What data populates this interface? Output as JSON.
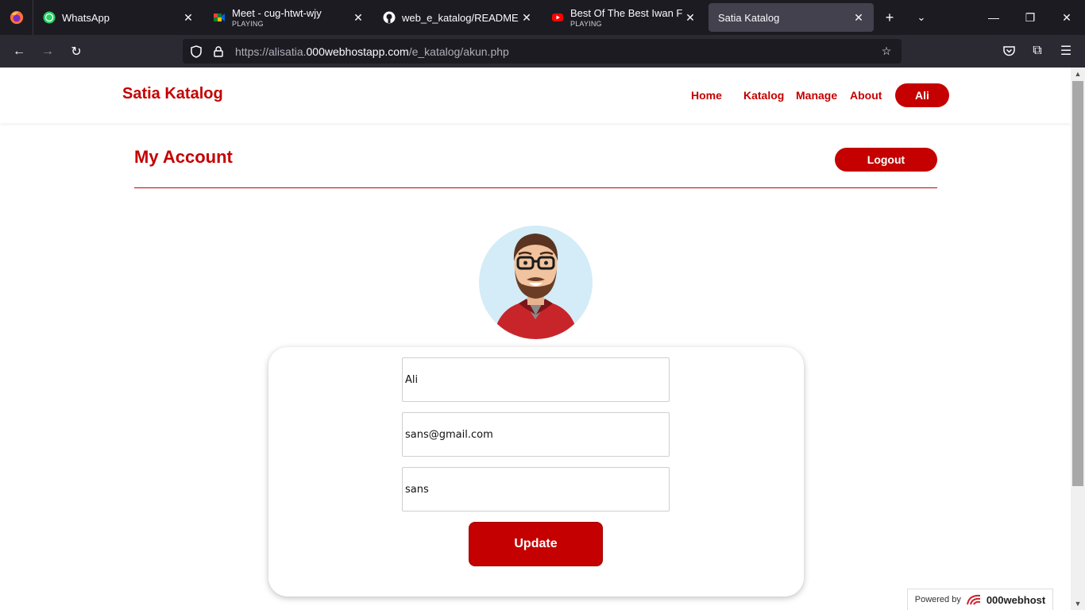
{
  "browser": {
    "tabs": [
      {
        "title": "WhatsApp",
        "icon": "whatsapp-icon",
        "sub": ""
      },
      {
        "title": "Meet - cug-htwt-wjy",
        "icon": "meet-icon",
        "sub": "PLAYING"
      },
      {
        "title": "web_e_katalog/README.md",
        "icon": "github-icon",
        "sub": ""
      },
      {
        "title": "Best Of The Best Iwan Fals ~ K",
        "icon": "youtube-icon",
        "sub": "PLAYING"
      },
      {
        "title": "Satia Katalog",
        "icon": "",
        "sub": ""
      }
    ],
    "url_prefix": "https://alisatia.",
    "url_domain": "000webhostapp.com",
    "url_path": "/e_katalog/akun.php"
  },
  "site": {
    "brand": "Satia Katalog",
    "nav": {
      "home": "Home",
      "katalog": "Katalog",
      "manage": "Manage",
      "about": "About",
      "user": "Ali"
    }
  },
  "account": {
    "title": "My Account",
    "logout": "Logout",
    "fields": {
      "name": "Ali",
      "email": "sans@gmail.com",
      "password": "sans"
    },
    "update": "Update"
  },
  "footer": {
    "powered_by": "Powered by",
    "host": "000webhost"
  },
  "colors": {
    "accent": "#c40000",
    "chrome_dark": "#1c1b22"
  }
}
